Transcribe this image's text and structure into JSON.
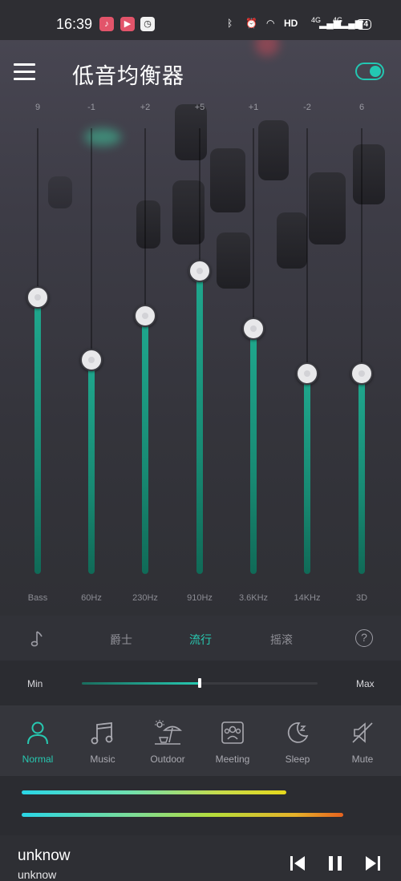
{
  "status_bar": {
    "time": "16:39",
    "network_label": "HD",
    "signal_1": "4G",
    "signal_2": "4G",
    "battery": "74"
  },
  "header": {
    "title": "低音均衡器",
    "power_on": true
  },
  "bands": [
    {
      "gain": "9",
      "freq": "Bass",
      "level": 0.62
    },
    {
      "gain": "-1",
      "freq": "60Hz",
      "level": 0.48
    },
    {
      "gain": "+2",
      "freq": "230Hz",
      "level": 0.58
    },
    {
      "gain": "+5",
      "freq": "910Hz",
      "level": 0.68
    },
    {
      "gain": "+1",
      "freq": "3.6KHz",
      "level": 0.55
    },
    {
      "gain": "-2",
      "freq": "14KHz",
      "level": 0.45
    },
    {
      "gain": "6",
      "freq": "3D",
      "level": 0.45
    }
  ],
  "presets": {
    "jazz": "爵士",
    "pop": "流行",
    "rock": "摇滚",
    "active": "pop",
    "help": "?"
  },
  "volume": {
    "min_label": "Min",
    "max_label": "Max",
    "level": 0.5
  },
  "modes": [
    {
      "label": "Normal",
      "icon": "person-icon",
      "active": true
    },
    {
      "label": "Music",
      "icon": "music-note-icon",
      "active": false
    },
    {
      "label": "Outdoor",
      "icon": "beach-umbrella-icon",
      "active": false
    },
    {
      "label": "Meeting",
      "icon": "meeting-icon",
      "active": false
    },
    {
      "label": "Sleep",
      "icon": "moon-icon",
      "active": false
    },
    {
      "label": "Mute",
      "icon": "mute-icon",
      "active": false
    }
  ],
  "spectrum": {
    "bar1_level": 0.74,
    "bar2_level": 0.9
  },
  "player": {
    "title": "unknow",
    "artist": "unknow"
  },
  "colors": {
    "accent": "#27c9b1",
    "background": "#2b2c31"
  }
}
